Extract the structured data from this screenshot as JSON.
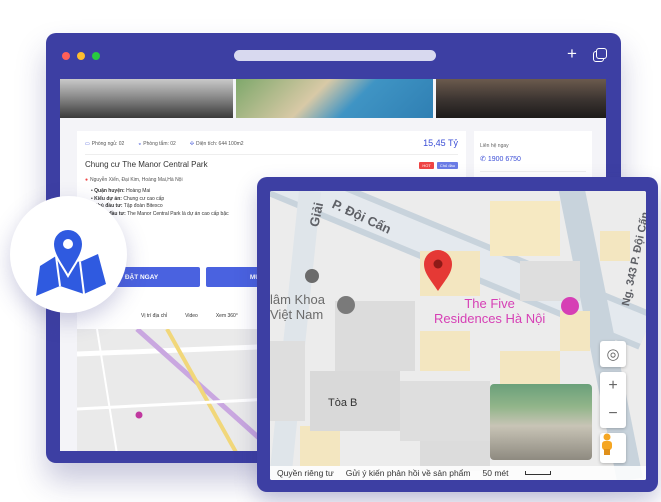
{
  "listing": {
    "meta": {
      "bedrooms": "Phòng ngủ: 02",
      "bathrooms": "Phòng tắm: 02",
      "area": "Diện tích: 644 100m2"
    },
    "price": "15,45 Tỷ",
    "title": "Chung cư The Manor Central Park",
    "tags": [
      "HOT",
      "Chủ đầu"
    ],
    "address": "Nguyễn Xiển, Đại Kim, Hoàng Mai,Hà Nội",
    "details": [
      {
        "label": "Quận huyện:",
        "value": "Hoàng Mai"
      },
      {
        "label": "Kiểu dự án:",
        "value": "Chung cư cao cấp"
      },
      {
        "label": "Chủ đầu tư:",
        "value": "Tập đoàn Bitexco"
      },
      {
        "label": "Mô tả đầu tư:",
        "value": "The Manor Central Park là dự án cao cấp bậc"
      }
    ],
    "buttons": {
      "book": "ĐẶT NGAY",
      "buy": "MUA THEO L"
    },
    "tabs": [
      "Vị trí địa chỉ",
      "Video",
      "Xem 360°"
    ]
  },
  "side_panel": {
    "contact_label": "Liên hệ ngay",
    "phone": "1900 6750"
  },
  "map": {
    "streets": [
      "P. Đội Cấn",
      "Ng. 343 P. Đội Cấn",
      "Giải"
    ],
    "poi_school": [
      "lâm Khoa",
      "Việt Nam"
    ],
    "poi_residence": [
      "The Five",
      "Residences Hà Nội"
    ],
    "building": "Tòa B",
    "footer": {
      "privacy": "Quyền riêng tư",
      "feedback": "Gửi ý kiến phản hồi về sản phẩm",
      "scale": "50 mét"
    },
    "controls": {
      "zoom_in": "+",
      "zoom_out": "−"
    }
  },
  "colors": {
    "window": "#3d3fa3",
    "accent": "#4a62e0",
    "pin": "#e53935",
    "poi_pink": "#d63fb5"
  },
  "icons": [
    "map-location-icon",
    "map-pin-icon",
    "locate-icon",
    "pegman-icon",
    "plus-icon",
    "copy-icon",
    "phone-icon"
  ]
}
